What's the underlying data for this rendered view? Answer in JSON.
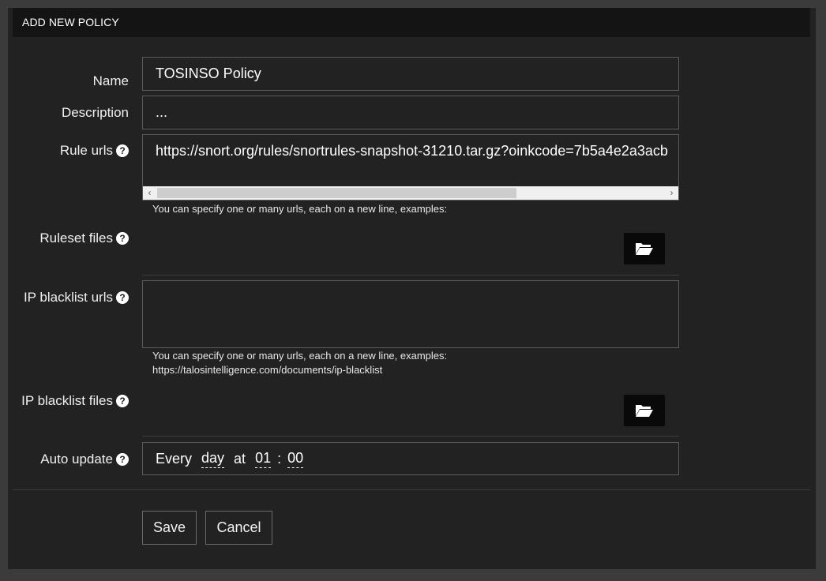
{
  "panel": {
    "title": "ADD NEW POLICY"
  },
  "form": {
    "name": {
      "label": "Name",
      "value": "TOSINSO Policy"
    },
    "description": {
      "label": "Description",
      "value": "..."
    },
    "rule_urls": {
      "label": "Rule urls",
      "help_icon": "question-circle-icon",
      "value": "https://snort.org/rules/snortrules-snapshot-31210.tar.gz?oinkcode=7b5a4e2a3acb",
      "hint": "You can specify one or many urls, each on a new line, examples:"
    },
    "ruleset_files": {
      "label": "Ruleset files",
      "help_icon": "question-circle-icon",
      "button_icon": "folder-open-icon"
    },
    "ip_blacklist_urls": {
      "label": "IP blacklist urls",
      "help_icon": "question-circle-icon",
      "value": "",
      "hint_line1": "You can specify one or many urls, each on a new line, examples:",
      "hint_line2": "https://talosintelligence.com/documents/ip-blacklist"
    },
    "ip_blacklist_files": {
      "label": "IP blacklist files",
      "help_icon": "question-circle-icon",
      "button_icon": "folder-open-icon"
    },
    "auto_update": {
      "label": "Auto update",
      "help_icon": "question-circle-icon",
      "every": "Every",
      "period": "day",
      "at": "at",
      "hour": "01",
      "colon": ":",
      "minute": "00"
    }
  },
  "actions": {
    "save": "Save",
    "cancel": "Cancel"
  },
  "colors": {
    "background": "#232223",
    "header": "#141414",
    "border": "#5a5a5a",
    "outer": "#3b3b3b"
  }
}
